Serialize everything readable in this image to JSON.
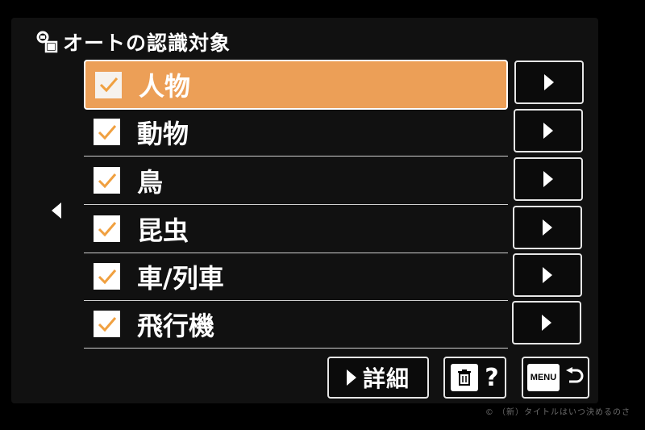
{
  "header": {
    "title": "オートの認識対象",
    "icon": "subject-recognition-icon"
  },
  "items": [
    {
      "label": "人物",
      "checked": true,
      "selected": true
    },
    {
      "label": "動物",
      "checked": true,
      "selected": false
    },
    {
      "label": "鳥",
      "checked": true,
      "selected": false
    },
    {
      "label": "昆虫",
      "checked": true,
      "selected": false
    },
    {
      "label": "車/列車",
      "checked": true,
      "selected": false
    },
    {
      "label": "飛行機",
      "checked": true,
      "selected": false
    }
  ],
  "footer": {
    "detail_label": "詳細",
    "help_label": "?",
    "menu_label": "MENU"
  },
  "watermark": "© （新）タイトルはいつ決めるのさ",
  "colors": {
    "highlight": "#ec9f57",
    "check": "#f0a040",
    "background": "#111111"
  }
}
